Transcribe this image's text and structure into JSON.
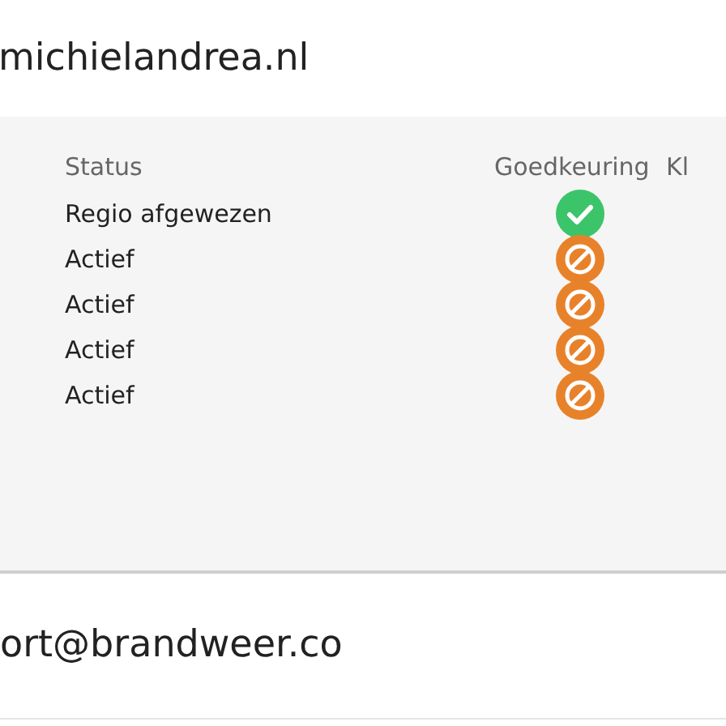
{
  "header": {
    "domain": "michielandrea.nl"
  },
  "table": {
    "columns": [
      "Status",
      "Goedkeuring",
      "Kl"
    ],
    "rows": [
      {
        "status": "Regio afgewezen",
        "kind": "approved"
      },
      {
        "status": "Actief",
        "kind": "denied"
      },
      {
        "status": "Actief",
        "kind": "denied"
      },
      {
        "status": "Actief",
        "kind": "denied"
      },
      {
        "status": "Actief",
        "kind": "denied"
      }
    ]
  },
  "footer": {
    "email": "ort@brandweer.co"
  }
}
